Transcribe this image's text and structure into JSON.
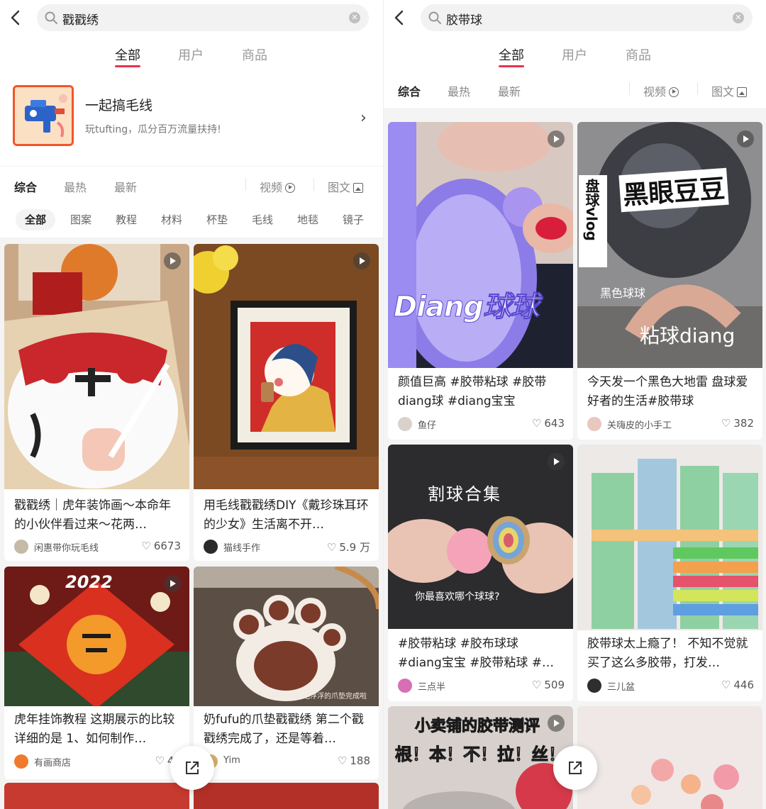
{
  "left": {
    "search": {
      "query": "戳戳绣"
    },
    "top_tabs": [
      {
        "label": "全部",
        "active": true
      },
      {
        "label": "用户",
        "active": false
      },
      {
        "label": "商品",
        "active": false
      }
    ],
    "topic": {
      "title": "一起搞毛线",
      "subtitle": "玩tufting，瓜分百万流量扶持!"
    },
    "filters": {
      "comprehensive": "综合",
      "hot": "最热",
      "latest": "最新",
      "video": "视频",
      "image_text": "图文"
    },
    "chips": [
      "全部",
      "图案",
      "教程",
      "材料",
      "杯垫",
      "毛线",
      "地毯",
      "镜子"
    ],
    "cards": [
      {
        "caption": "戳戳绣｜虎年装饰画～本命年的小伙伴看过来～花两…",
        "author": "闲惠带你玩毛线",
        "likes": "6673",
        "is_video": true
      },
      {
        "caption": "用毛线戳戳绣DIY《戴珍珠耳环的少女》生活离不开…",
        "author": "猫线手作",
        "likes": "5.9 万",
        "is_video": true
      },
      {
        "caption": "虎年挂饰教程 这期展示的比较详细的是 1、如何制作…",
        "author": "有画商店",
        "likes": "48",
        "is_video": true,
        "overlay": "2022"
      },
      {
        "caption": "奶fufu的爪垫戳戳绣 第二个戳戳绣完成了，还是等着…",
        "author": "Yim",
        "likes": "188",
        "is_video": false,
        "overlay": "毛浮浮的爪垫完成啦"
      }
    ]
  },
  "right": {
    "search": {
      "query": "胶带球"
    },
    "top_tabs": [
      {
        "label": "全部",
        "active": true
      },
      {
        "label": "用户",
        "active": false
      },
      {
        "label": "商品",
        "active": false
      }
    ],
    "filters": {
      "comprehensive": "综合",
      "hot": "最热",
      "latest": "最新",
      "video": "视频",
      "image_text": "图文"
    },
    "cards": [
      {
        "caption": "颜值巨高 #胶带粘球 #胶带diang球 #diang宝宝",
        "author": "鱼仔",
        "likes": "643",
        "is_video": true,
        "overlay": "Diang球球"
      },
      {
        "caption": "今天发一个黑色大地雷 盘球爱好者的生活#胶带球",
        "author": "关嗨皮的小手工",
        "likes": "382",
        "is_video": true,
        "overlay": "黑眼豆豆",
        "overlay2": "盘球vlog",
        "overlay3": "黑色球球",
        "overlay4": "粘球diang"
      },
      {
        "caption": "#胶带粘球 #胶布球球 #diang宝宝 #胶带粘球 #…",
        "author": "三点半",
        "likes": "509",
        "is_video": true,
        "overlay": "割球合集",
        "overlay2": "你最喜欢哪个球球?"
      },
      {
        "caption": "胶带球太上瘾了！ 不知不觉就买了这么多胶带，打发…",
        "author": "三儿盆",
        "likes": "446",
        "is_video": false
      },
      {
        "caption": "",
        "is_video": true,
        "overlay": "小卖铺的胶带测评",
        "overlay2": "根！本！不！拉！丝！"
      },
      {
        "caption": "",
        "is_video": false
      }
    ]
  },
  "colors": {
    "accent": "#e8334a",
    "bg": "#f4f4f4"
  }
}
